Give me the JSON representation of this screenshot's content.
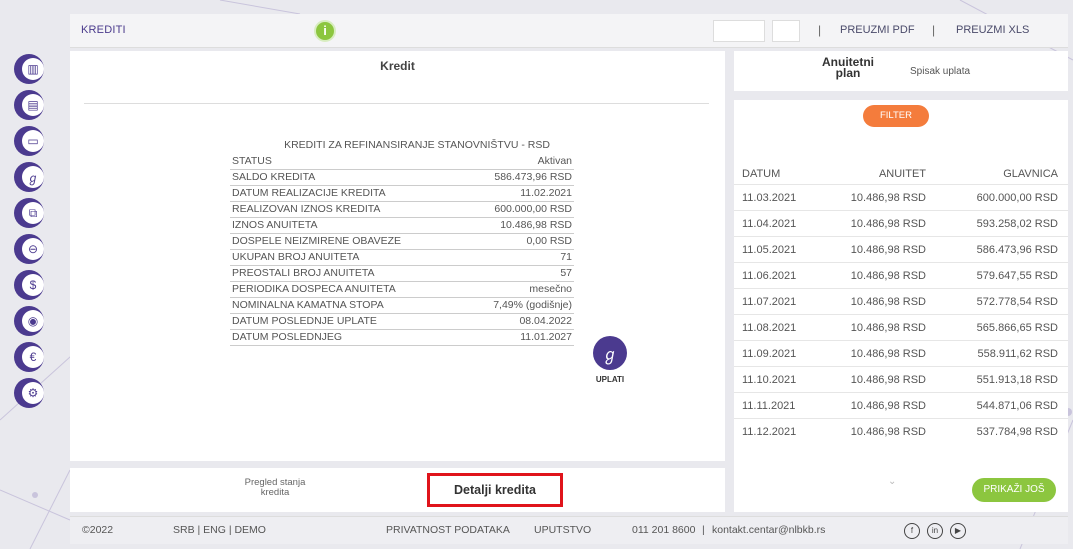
{
  "topbar": {
    "crumb": "KREDITI",
    "info_icon": "i",
    "download_pdf": "PREUZMI PDF",
    "download_xls": "PREUZMI XLS"
  },
  "sidebar": {
    "icons": [
      "chart-icon",
      "documents-icon",
      "card-icon",
      "signature-icon",
      "devices-icon",
      "minus-icon",
      "dollar-icon",
      "location-icon",
      "euro-icon",
      "settings-icon"
    ]
  },
  "main": {
    "title": "Kredit",
    "subtitle": "KREDITI ZA REFINANSIRANJE STANOVNIŠTVU - RSD",
    "details": [
      {
        "k": "STATUS",
        "v": "Aktivan"
      },
      {
        "k": "SALDO KREDITA",
        "v": "586.473,96 RSD"
      },
      {
        "k": "DATUM REALIZACIJE KREDITA",
        "v": "11.02.2021"
      },
      {
        "k": "REALIZOVAN IZNOS KREDITA",
        "v": "600.000,00 RSD"
      },
      {
        "k": "IZNOS ANUITETA",
        "v": "10.486,98 RSD"
      },
      {
        "k": "DOSPELE NEIZMIRENE OBAVEZE",
        "v": "0,00 RSD"
      },
      {
        "k": "UKUPAN BROJ ANUITETA",
        "v": "71"
      },
      {
        "k": "PREOSTALI BROJ ANUITETA",
        "v": "57"
      },
      {
        "k": "PERIODIKA DOSPECA ANUITETA",
        "v": "mesečno"
      },
      {
        "k": "NOMINALNA KAMATNA STOPA",
        "v": "7,49% (godišnje)"
      },
      {
        "k": "DATUM POSLEDNJE UPLATE",
        "v": "08.04.2022"
      },
      {
        "k": "DATUM POSLEDNJEG",
        "v": "11.01.2027"
      }
    ],
    "pay_label": "UPLATI"
  },
  "tabs": {
    "overview": "Pregled stanja kredita",
    "details": "Detalji kredita"
  },
  "right": {
    "tab_plan": "Anuitetni plan",
    "tab_payments": "Spisak uplata",
    "filter": "FILTER",
    "headers": {
      "date": "DATUM",
      "annuity": "ANUITET",
      "principal": "GLAVNICA"
    },
    "rows": [
      {
        "date": "11.03.2021",
        "annuity": "10.486,98 RSD",
        "principal": "600.000,00 RSD"
      },
      {
        "date": "11.04.2021",
        "annuity": "10.486,98 RSD",
        "principal": "593.258,02 RSD"
      },
      {
        "date": "11.05.2021",
        "annuity": "10.486,98 RSD",
        "principal": "586.473,96 RSD"
      },
      {
        "date": "11.06.2021",
        "annuity": "10.486,98 RSD",
        "principal": "579.647,55 RSD"
      },
      {
        "date": "11.07.2021",
        "annuity": "10.486,98 RSD",
        "principal": "572.778,54 RSD"
      },
      {
        "date": "11.08.2021",
        "annuity": "10.486,98 RSD",
        "principal": "565.866,65 RSD"
      },
      {
        "date": "11.09.2021",
        "annuity": "10.486,98 RSD",
        "principal": "558.911,62 RSD"
      },
      {
        "date": "11.10.2021",
        "annuity": "10.486,98 RSD",
        "principal": "551.913,18 RSD"
      },
      {
        "date": "11.11.2021",
        "annuity": "10.486,98 RSD",
        "principal": "544.871,06 RSD"
      },
      {
        "date": "11.12.2021",
        "annuity": "10.486,98 RSD",
        "principal": "537.784,98 RSD"
      }
    ],
    "show_more": "PRIKAŽI JOŠ"
  },
  "footer": {
    "copyright": "©2022",
    "langs": "SRB  |  ENG  |  DEMO",
    "privacy": "PRIVATNOST PODATAKA",
    "guide": "UPUTSTVO",
    "phone": "011 201 8600",
    "email": "kontakt.centar@nlbkb.rs"
  },
  "colors": {
    "brand": "#4b3a8f",
    "accent_green": "#8cc63f",
    "filter_orange": "#f47c3c",
    "highlight_red": "#e0141b"
  }
}
